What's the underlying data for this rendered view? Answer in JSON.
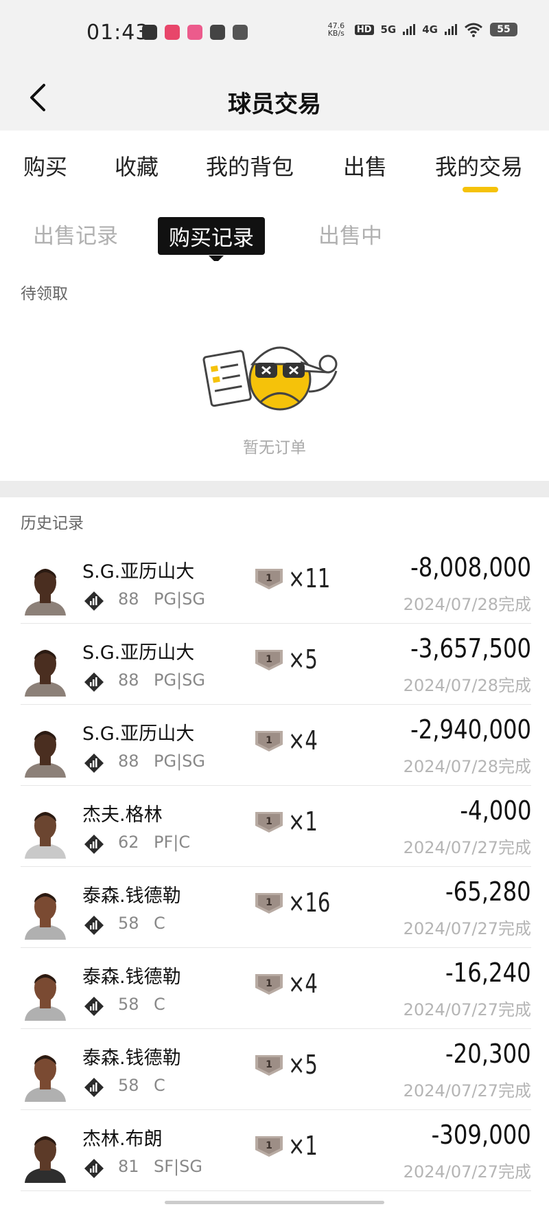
{
  "status_bar": {
    "time": "01:43",
    "net_speed_value": "47.6",
    "net_speed_unit": "KB/s",
    "hd_label": "HD",
    "network_1": "5G",
    "network_2": "4G",
    "battery": "55"
  },
  "header": {
    "title": "球员交易"
  },
  "tabs": [
    {
      "label": "购买"
    },
    {
      "label": "收藏"
    },
    {
      "label": "我的背包"
    },
    {
      "label": "出售"
    },
    {
      "label": "我的交易"
    }
  ],
  "active_tab": "我的交易",
  "subtabs": [
    {
      "label": "出售记录"
    },
    {
      "label": "购买记录"
    },
    {
      "label": "出售中"
    }
  ],
  "active_subtab": "购买记录",
  "pending": {
    "label": "待领取",
    "empty_text": "暂无订单"
  },
  "history": {
    "label": "历史记录",
    "rows": [
      {
        "name": "S.G.亚历山大",
        "rating": "88",
        "position": "PG|SG",
        "card_level": "1",
        "quantity": "×11",
        "price": "-8,008,000",
        "date": "2024/07/28完成"
      },
      {
        "name": "S.G.亚历山大",
        "rating": "88",
        "position": "PG|SG",
        "card_level": "1",
        "quantity": "×5",
        "price": "-3,657,500",
        "date": "2024/07/28完成"
      },
      {
        "name": "S.G.亚历山大",
        "rating": "88",
        "position": "PG|SG",
        "card_level": "1",
        "quantity": "×4",
        "price": "-2,940,000",
        "date": "2024/07/28完成"
      },
      {
        "name": "杰夫.格林",
        "rating": "62",
        "position": "PF|C",
        "card_level": "1",
        "quantity": "×1",
        "price": "-4,000",
        "date": "2024/07/27完成"
      },
      {
        "name": "泰森.钱德勒",
        "rating": "58",
        "position": "C",
        "card_level": "1",
        "quantity": "×16",
        "price": "-65,280",
        "date": "2024/07/27完成"
      },
      {
        "name": "泰森.钱德勒",
        "rating": "58",
        "position": "C",
        "card_level": "1",
        "quantity": "×4",
        "price": "-16,240",
        "date": "2024/07/27完成"
      },
      {
        "name": "泰森.钱德勒",
        "rating": "58",
        "position": "C",
        "card_level": "1",
        "quantity": "×5",
        "price": "-20,300",
        "date": "2024/07/27完成"
      },
      {
        "name": "杰林.布朗",
        "rating": "81",
        "position": "SF|SG",
        "card_level": "1",
        "quantity": "×1",
        "price": "-309,000",
        "date": "2024/07/27完成"
      }
    ]
  },
  "colors": {
    "accent": "#f5c20a",
    "subtab_active_bg": "#111111"
  }
}
